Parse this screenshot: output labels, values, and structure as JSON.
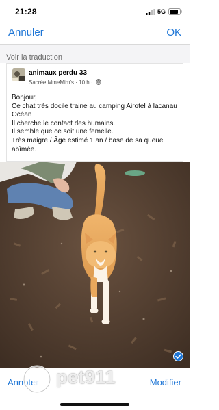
{
  "status_bar": {
    "time": "21:28",
    "network": "5G"
  },
  "nav": {
    "cancel_label": "Annuler",
    "ok_label": "OK"
  },
  "translation": {
    "link_label": "Voir la traduction"
  },
  "post": {
    "group_name": "animaux perdu 33",
    "author": "Sacrée MmeMim's",
    "time_ago": "10 h",
    "separator": "·",
    "body_lines": [
      "Bonjour,",
      "Ce chat très docile traine au camping Airotel à lacanau Océan",
      "Il cherche le contact des humains.",
      "Il semble que ce soit une femelle.",
      "Très maigre / Âge estimé 1 an / base de sa queue abîmée."
    ]
  },
  "bottom_bar": {
    "annotate_label": "Annoter",
    "modify_label": "Modifier"
  },
  "watermark": {
    "text": "pet911"
  },
  "colors": {
    "accent": "#1e76d6",
    "ground": "#4e3a2c",
    "cat_orange": "#e7a45a"
  }
}
